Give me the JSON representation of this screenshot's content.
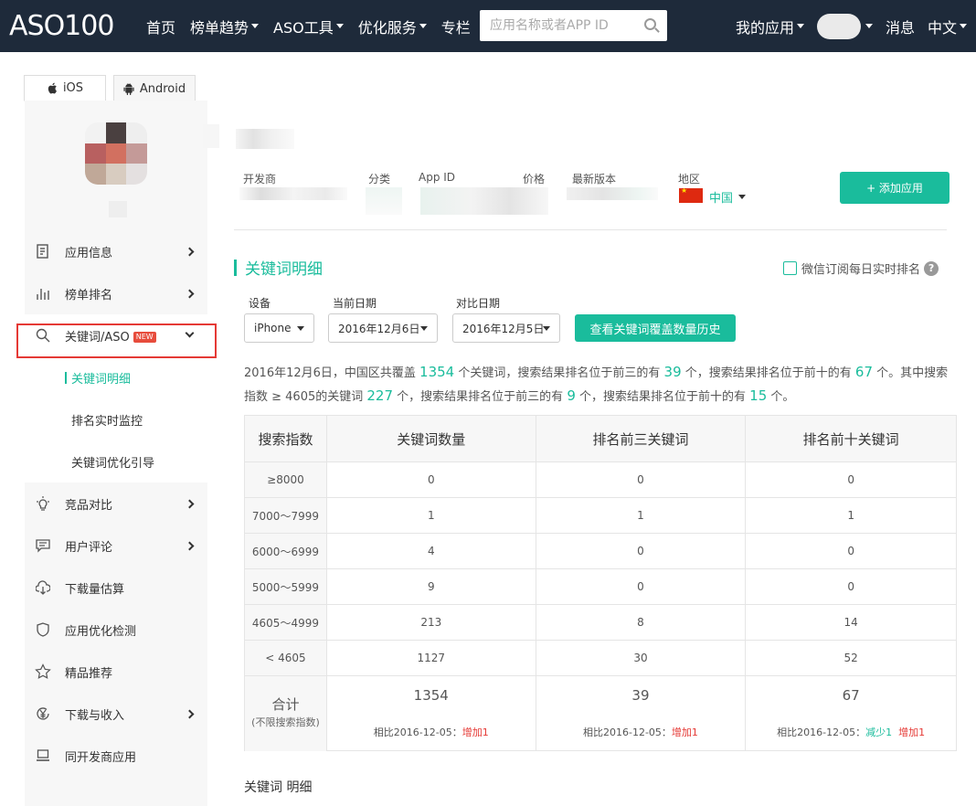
{
  "nav": {
    "logo": "ASO100",
    "links": [
      {
        "label": "首页",
        "dropdown": false
      },
      {
        "label": "榜单趋势",
        "dropdown": true
      },
      {
        "label": "ASO工具",
        "dropdown": true
      },
      {
        "label": "优化服务",
        "dropdown": true
      },
      {
        "label": "专栏",
        "dropdown": false
      }
    ],
    "search_placeholder": "应用名称或者APP ID",
    "my_apps": "我的应用",
    "messages": "消息",
    "language": "中文"
  },
  "platform_tabs": [
    {
      "label": "iOS",
      "active": true
    },
    {
      "label": "Android",
      "active": false
    }
  ],
  "sidebar": {
    "items": [
      {
        "label": "应用信息",
        "icon": "document-list-icon",
        "chevron": "right"
      },
      {
        "label": "榜单排名",
        "icon": "bar-chart-icon",
        "chevron": "right"
      },
      {
        "label": "关键词/ASO",
        "icon": "search-icon",
        "chevron": "down",
        "badge": "NEW"
      },
      {
        "label": "竞品对比",
        "icon": "lightbulb-icon",
        "chevron": "right"
      },
      {
        "label": "用户评论",
        "icon": "comment-icon",
        "chevron": "right"
      },
      {
        "label": "下载量估算",
        "icon": "cloud-download-icon",
        "chevron": ""
      },
      {
        "label": "应用优化检测",
        "icon": "shield-icon",
        "chevron": ""
      },
      {
        "label": "精品推荐",
        "icon": "star-icon",
        "chevron": ""
      },
      {
        "label": "下载与收入",
        "icon": "yen-coin-icon",
        "chevron": "right"
      },
      {
        "label": "同开发商应用",
        "icon": "laptop-icon",
        "chevron": ""
      }
    ],
    "sub_items": [
      {
        "label": "关键词明细",
        "active": true
      },
      {
        "label": "排名实时监控",
        "active": false
      },
      {
        "label": "关键词优化引导",
        "active": false
      }
    ]
  },
  "app_info": {
    "labels": {
      "developer": "开发商",
      "category": "分类",
      "app_id": "App ID",
      "price": "价格",
      "version": "最新版本",
      "region": "地区"
    },
    "region_value": "中国",
    "add_button": "+ 添加应用"
  },
  "keyword_section": {
    "title": "关键词明细",
    "wechat_subscribe": "微信订阅每日实时排名",
    "help": "?",
    "filters": {
      "device_label": "设备",
      "device_value": "iPhone",
      "date_label": "当前日期",
      "date_value": "2016年12月6日",
      "compare_label": "对比日期",
      "compare_value": "2016年12月5日",
      "history_button": "查看关键词覆盖数量历史"
    },
    "summary": {
      "p1": "2016年12月6日，中国区共覆盖",
      "n1": "1354",
      "p2": "个关键词，搜索结果排名位于前三的有",
      "n2": "39",
      "p3": "个，搜索结果排名位于前十的有",
      "n3": "67",
      "p4": "个。其中搜索指数 ≥ 4605的关键词",
      "n4": "227",
      "p5": "个，搜索结果排名位于前三的有",
      "n5": "9",
      "p6": "个，搜索结果排名位于前十的有",
      "n6": "15",
      "p7": "个。"
    },
    "table": {
      "headers": [
        "搜索指数",
        "关键词数量",
        "排名前三关键词",
        "排名前十关键词"
      ],
      "rows": [
        [
          "≥8000",
          "0",
          "0",
          "0"
        ],
        [
          "7000～7999",
          "1",
          "1",
          "1"
        ],
        [
          "6000～6999",
          "4",
          "0",
          "0"
        ],
        [
          "5000～5999",
          "9",
          "0",
          "0"
        ],
        [
          "4605～4999",
          "213",
          "8",
          "14"
        ],
        [
          "< 4605",
          "1127",
          "30",
          "52"
        ]
      ],
      "total_label": "合计",
      "total_note": "(不限搜索指数)",
      "totals": [
        "1354",
        "39",
        "67"
      ],
      "compare_prefix": "相比2016-12-05：",
      "compare": [
        {
          "dec": "",
          "inc": "增加1"
        },
        {
          "dec": "",
          "inc": "增加1"
        },
        {
          "dec": "减少1",
          "inc": "增加1"
        }
      ]
    },
    "bottom_title": "关键词 明细"
  },
  "colors": {
    "accent": "#1abc9c",
    "nav_bg": "#1e2a3a",
    "highlight_border": "#e53935"
  }
}
